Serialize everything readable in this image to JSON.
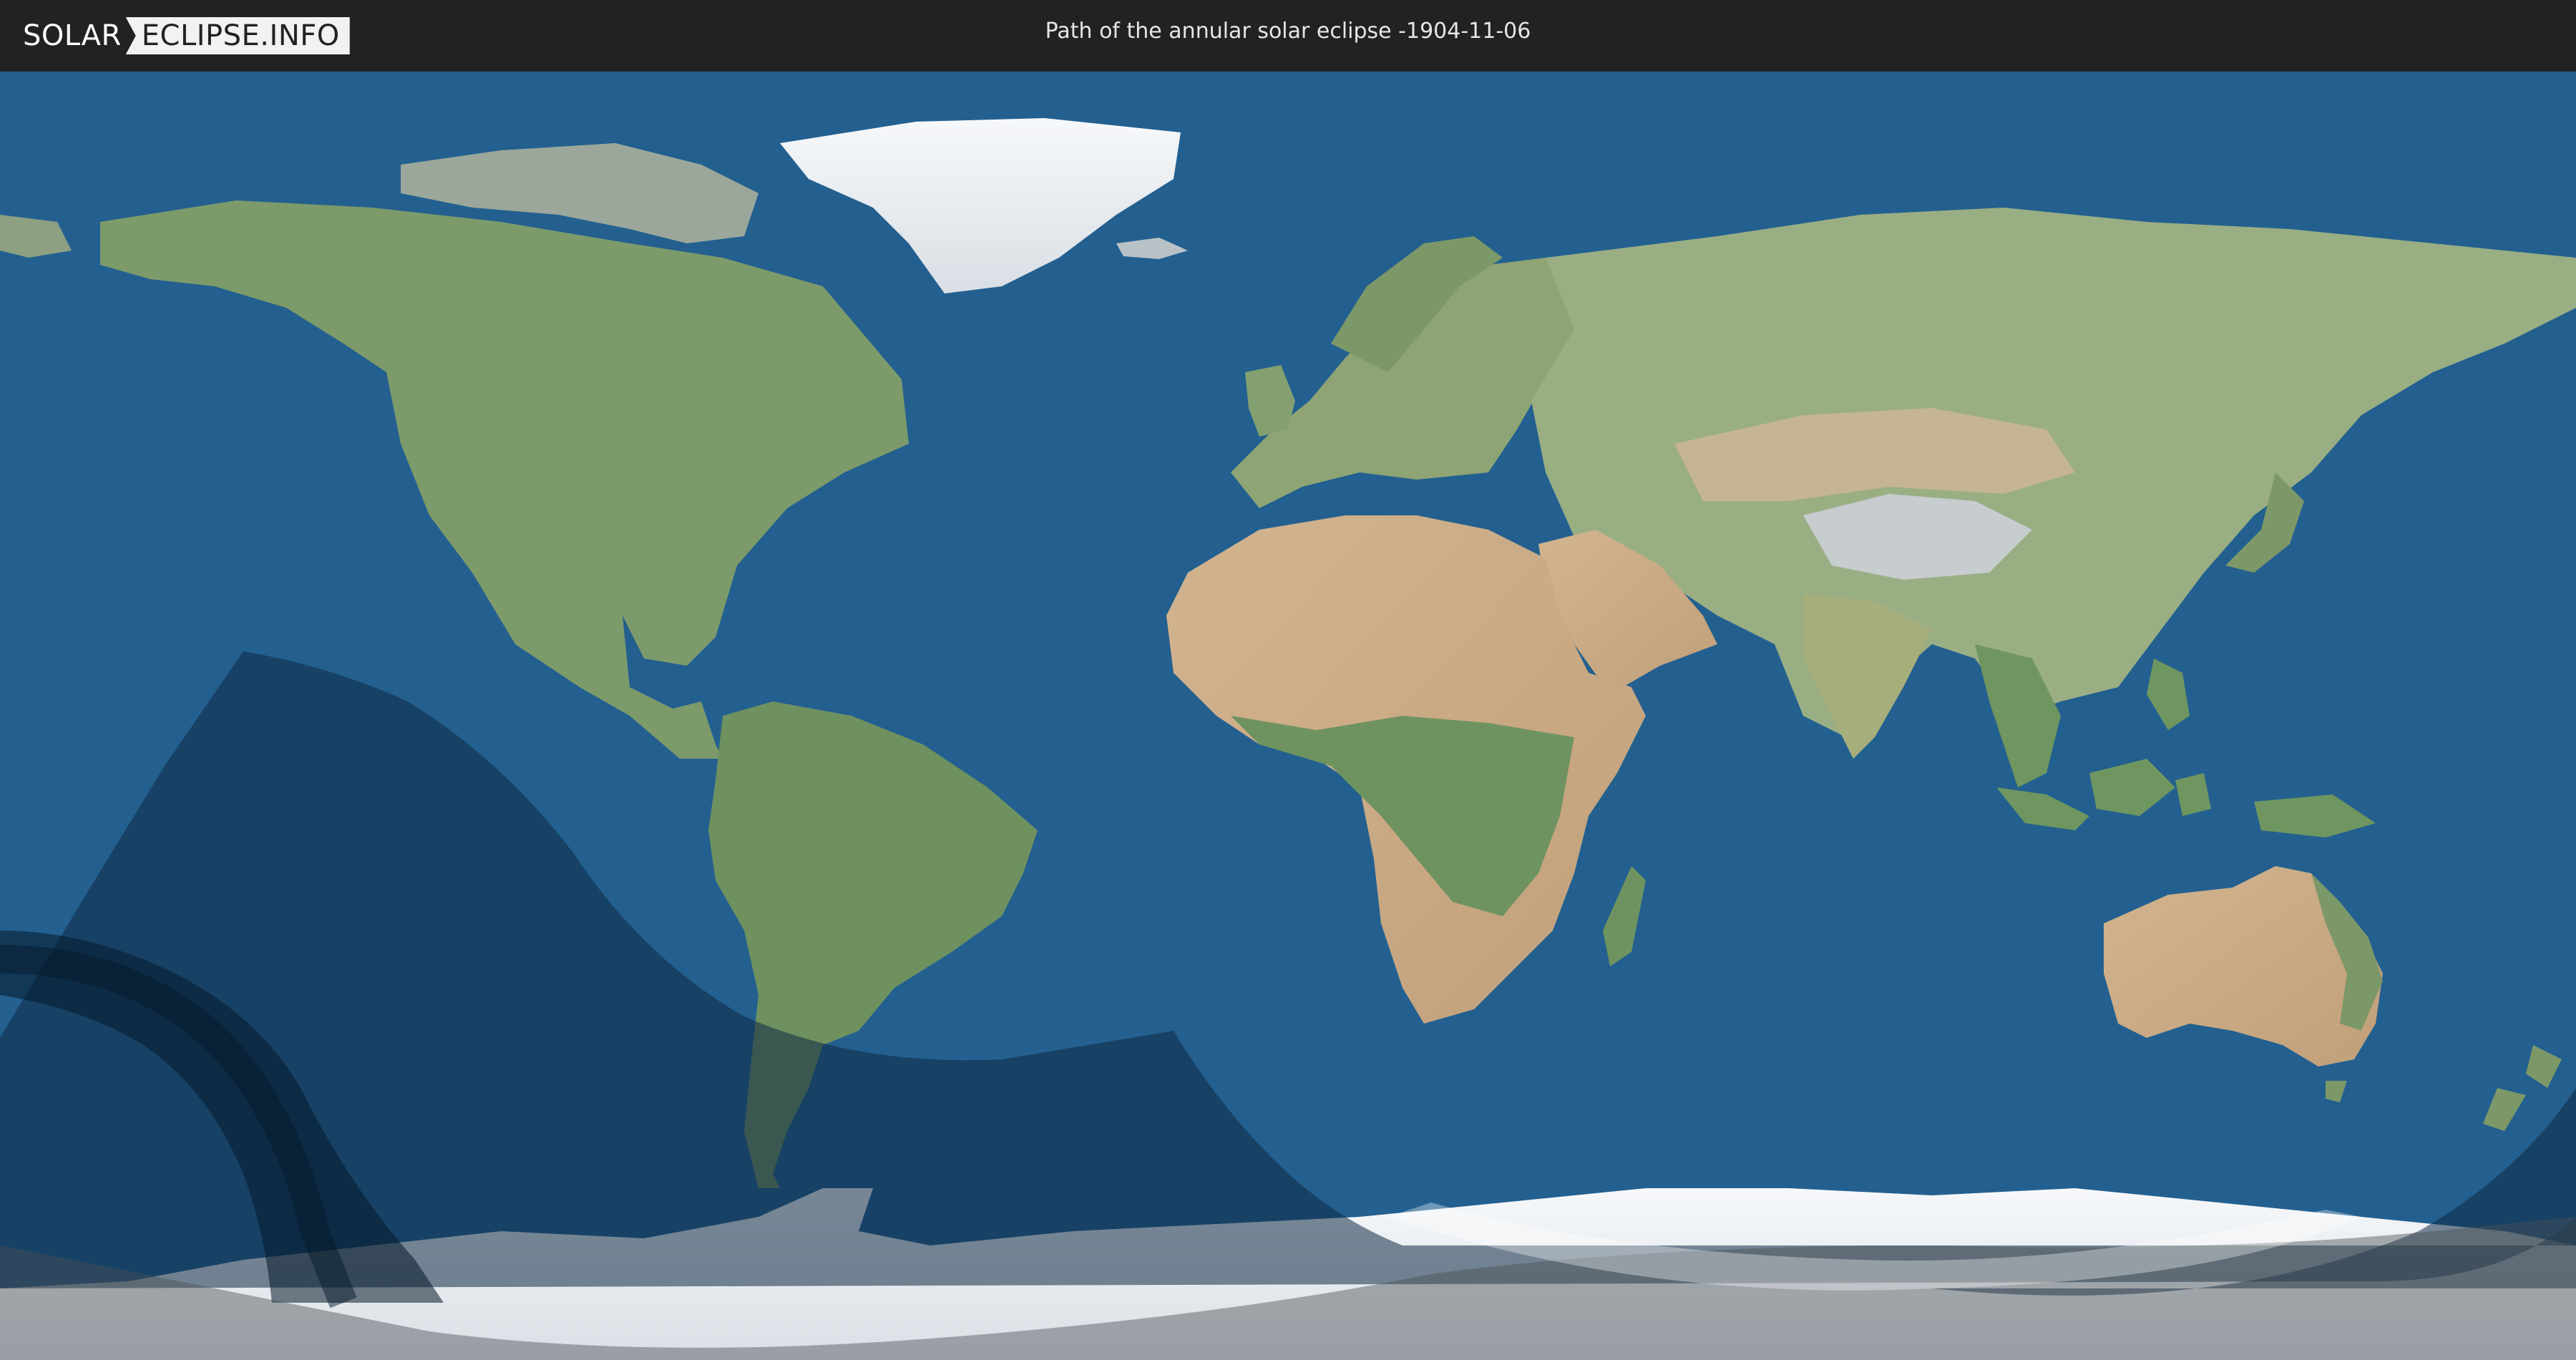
{
  "header": {
    "logo_part1": "SOLAR",
    "logo_part2": "ECLIPSE.INFO",
    "title": "Path of the annular solar eclipse -1904-11-06"
  },
  "colors": {
    "header_bg": "#222222",
    "ocean": "#236090",
    "land_green": "#7a9868",
    "land_desert": "#c8ae88",
    "ice": "#eef2f6",
    "partial_zone": "#1a3c5e",
    "central_path": "#0b2438",
    "shadow_overlay": "#a0a0a0"
  },
  "icons": {
    "logo": "solar-eclipse-logo"
  }
}
